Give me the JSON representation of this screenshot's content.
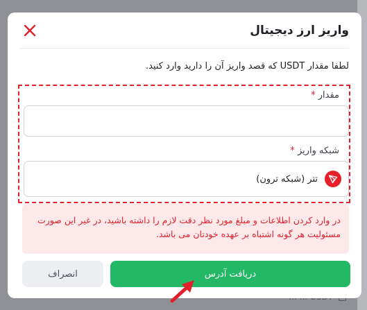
{
  "backdrop": {
    "row_text": "USDT ... ..."
  },
  "modal": {
    "title": "واریز ارز دیجیتال",
    "instruction": "لطفا مقدار USDT که قصد واریز آن را دارید وارد کنید.",
    "amount": {
      "label": "مقدار",
      "required_mark": "*",
      "value": "",
      "placeholder": ""
    },
    "network": {
      "label": "شبکه واریز",
      "required_mark": "*",
      "selected": "تتر (شبکه ترون)",
      "icon": "tron-icon"
    },
    "warning_line1": "در وارد کردن اطلاعات و مبلغ مورد نظر دقت لازم را داشته باشید، در غیر این صورت",
    "warning_line2": "مسئولیت هر گونه اشتباه بر عهده خودتان می باشد.",
    "submit_label": "دریافت آدرس",
    "cancel_label": "انصراف",
    "close_icon": "close-icon",
    "colors": {
      "accent_green": "#22b866",
      "danger_red": "#e0212b",
      "warning_bg": "#fde8ea"
    }
  }
}
